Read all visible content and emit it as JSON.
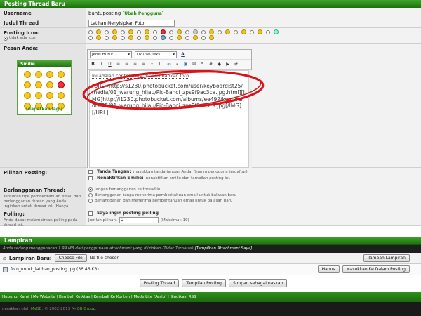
{
  "thread_header": "Posting Thread Baru",
  "username": {
    "label": "Username",
    "value": "bantuposting",
    "change_link": "[Ubah Pengguna]"
  },
  "title": {
    "label": "Judul Thread",
    "value": "Latihan Menyisipkan Foto"
  },
  "post_icon": {
    "label": "Posting Icon:",
    "none_label": "tidak ada icon"
  },
  "message": {
    "label": "Pesan Anda:",
    "font_select": "Jenis Huruf",
    "size_select": "Ukuran Teks",
    "first_line": "Ini adalah contoh cara menambahkan foto",
    "body_text": "[URL=http://s1230.photobucket.com/user/keyboardist25/media/01_warung_hijau/Pic-Banci_zps9f9ac3ca.jpg.html][IMG]http://i1230.photobucket.com/albums/ee492/keyboardist25/01_warung_hijau/Pic-Banci_zps9f9ac3ca.jpg[/IMG][/URL]"
  },
  "smilies": {
    "title": "Smilie",
    "more_link": "[dapatkan lagi]"
  },
  "options": {
    "label": "Pilihan Posting:",
    "signature_bold": "Tanda Tangan:",
    "signature_text": "masukkan tanda tangan Anda. (hanya pengguna terdaftar)",
    "disable_smilies_bold": "Nonaktifkan Smilie:",
    "disable_smilies_text": "nonaktifkan smilie dari tampilan posting ini."
  },
  "subscription": {
    "label": "Berlangganan Thread:",
    "desc": "Tentukan tipe pemberitahuan email dan berlangganan thread yang Anda inginkan untuk thread ini. (Hanya pengguna terdaftar)",
    "opt1": "Jangan berlangganan ke thread ini",
    "opt2": "Berlangganan tanpa menerima pemberitahuan email untuk balasan baru",
    "opt3": "Berlangganan dan menerima pemberitahuan email untuk balasan baru"
  },
  "poll": {
    "label": "Polling:",
    "desc": "Anda dapat melampirkan polling pada thread ini.",
    "check_label": "Saya ingin posting polling",
    "count_label": "Jumlah pilihan:",
    "count_value": "2",
    "max_label": "(Maksimal: 10)"
  },
  "attachments": {
    "header": "Lampiran",
    "usage_text": "Anda sedang menggunakan 1.99 MB dari penggunaan attachment yang diizinkan (Tidak Terbatas)",
    "usage_link": "[Tampilkan Attachment Saya]",
    "new_label": "Lampiran Baru:",
    "choose_button": "Choose File",
    "no_file": "No file chosen",
    "add_button": "Tambah Lampiran",
    "file_name": "foto_untuk_latihan_posting.jpg (36.46 KB)",
    "delete_button": "Hapus",
    "insert_button": "Masukkan Ke Dalam Posting"
  },
  "actions": {
    "post": "Posting Thread",
    "preview": "Tampilan Posting",
    "save_draft": "Simpan sebagai naskah"
  },
  "footer_links": [
    "Hubungi Kami",
    "My Website",
    "Kembali Ke Atas",
    "Kembali Ke Konten",
    "Mode Lite (Arsip)",
    "Sindikasi RSS"
  ],
  "powered_by": {
    "prefix": "gerakkan oleh",
    "mybb": "MyBB",
    "years": ", © 2002-2013",
    "group": "MyBB Group."
  },
  "colors": {
    "header_green": "#2d8a1a",
    "link_green": "#2c8a12",
    "annotation_red": "#d8141a"
  }
}
